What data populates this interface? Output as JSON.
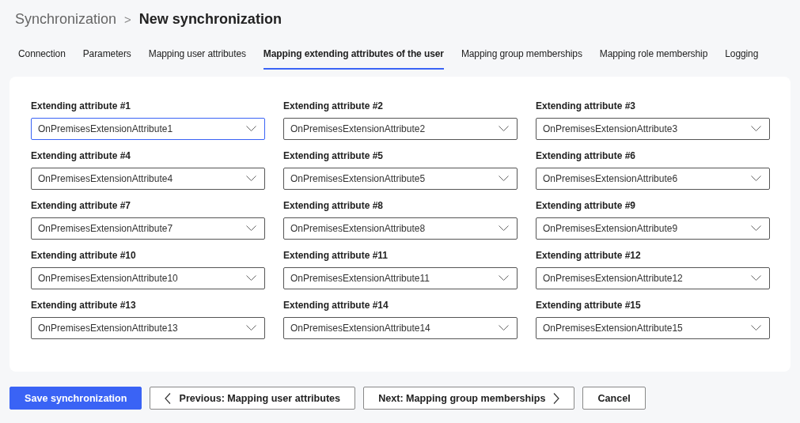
{
  "breadcrumb": {
    "parent": "Synchronization",
    "separator": ">",
    "current": "New synchronization"
  },
  "tabs": [
    {
      "label": "Connection",
      "selected": false
    },
    {
      "label": "Parameters",
      "selected": false
    },
    {
      "label": "Mapping user attributes",
      "selected": false
    },
    {
      "label": "Mapping extending attributes of the user",
      "selected": true
    },
    {
      "label": "Mapping group memberships",
      "selected": false
    },
    {
      "label": "Mapping role membership",
      "selected": false
    },
    {
      "label": "Logging",
      "selected": false
    }
  ],
  "fields": [
    {
      "label": "Extending attribute #1",
      "value": "OnPremisesExtensionAttribute1",
      "focused": true
    },
    {
      "label": "Extending attribute #2",
      "value": "OnPremisesExtensionAttribute2",
      "focused": false
    },
    {
      "label": "Extending attribute #3",
      "value": "OnPremisesExtensionAttribute3",
      "focused": false
    },
    {
      "label": "Extending attribute #4",
      "value": "OnPremisesExtensionAttribute4",
      "focused": false
    },
    {
      "label": "Extending attribute #5",
      "value": "OnPremisesExtensionAttribute5",
      "focused": false
    },
    {
      "label": "Extending attribute #6",
      "value": "OnPremisesExtensionAttribute6",
      "focused": false
    },
    {
      "label": "Extending attribute #7",
      "value": "OnPremisesExtensionAttribute7",
      "focused": false
    },
    {
      "label": "Extending attribute #8",
      "value": "OnPremisesExtensionAttribute8",
      "focused": false
    },
    {
      "label": "Extending attribute #9",
      "value": "OnPremisesExtensionAttribute9",
      "focused": false
    },
    {
      "label": "Extending attribute #10",
      "value": "OnPremisesExtensionAttribute10",
      "focused": false
    },
    {
      "label": "Extending attribute #11",
      "value": "OnPremisesExtensionAttribute11",
      "focused": false
    },
    {
      "label": "Extending attribute #12",
      "value": "OnPremisesExtensionAttribute12",
      "focused": false
    },
    {
      "label": "Extending attribute #13",
      "value": "OnPremisesExtensionAttribute13",
      "focused": false
    },
    {
      "label": "Extending attribute #14",
      "value": "OnPremisesExtensionAttribute14",
      "focused": false
    },
    {
      "label": "Extending attribute #15",
      "value": "OnPremisesExtensionAttribute15",
      "focused": false
    }
  ],
  "buttons": [
    {
      "label": "Save synchronization",
      "kind": "primary"
    },
    {
      "label": "Previous: Mapping user attributes",
      "kind": "previous"
    },
    {
      "label": "Next: Mapping group memberships",
      "kind": "next"
    },
    {
      "label": "Cancel",
      "kind": "plain"
    }
  ]
}
